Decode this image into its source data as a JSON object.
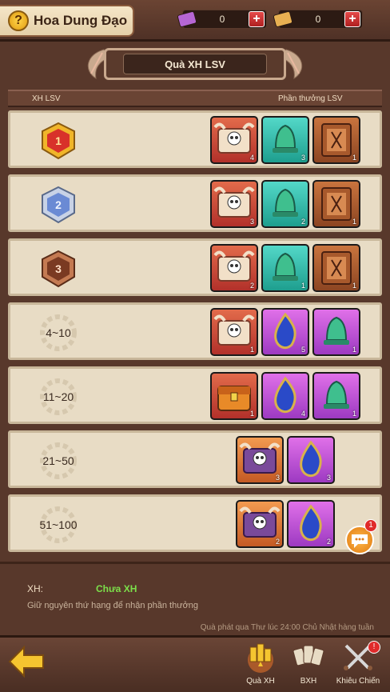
{
  "header": {
    "title": "Hoa Dung Đạo",
    "help": "?",
    "resources": [
      {
        "value": "0",
        "plus": "+",
        "color": "#b666d4"
      },
      {
        "value": "0",
        "plus": "+",
        "color": "#e8b052"
      }
    ]
  },
  "panel": {
    "title": "Quà XH LSV",
    "col_left": "XH LSV",
    "col_right": "Phần thưởng LSV"
  },
  "rows": [
    {
      "rank": "1",
      "items": [
        {
          "count": "4"
        },
        {
          "count": "3"
        },
        {
          "count": "1"
        }
      ]
    },
    {
      "rank": "2",
      "items": [
        {
          "count": "3"
        },
        {
          "count": "2"
        },
        {
          "count": "1"
        }
      ]
    },
    {
      "rank": "3",
      "items": [
        {
          "count": "2"
        },
        {
          "count": "1"
        },
        {
          "count": "1"
        }
      ]
    },
    {
      "rank": "4~10",
      "items": [
        {
          "count": "1"
        },
        {
          "count": "5"
        },
        {
          "count": "1"
        }
      ]
    },
    {
      "rank": "11~20",
      "items": [
        {
          "count": "1"
        },
        {
          "count": "4"
        },
        {
          "count": "1"
        }
      ]
    },
    {
      "rank": "21~50",
      "items": [
        {
          "count": "3"
        },
        {
          "count": "3"
        }
      ]
    },
    {
      "rank": "51~100",
      "items": [
        {
          "count": "2"
        },
        {
          "count": "2"
        }
      ]
    }
  ],
  "info": {
    "label": "XH:",
    "status": "Chưa XH",
    "desc": "Giữ nguyên thứ hạng để nhận phần thưởng",
    "time": "Quà phát qua Thư lúc 24:00 Chủ Nhật hàng tuần"
  },
  "chat_badge": "1",
  "nav": [
    {
      "label": "Quà XH",
      "active": true
    },
    {
      "label": "BXH"
    },
    {
      "label": "Khiêu Chiến",
      "badge": "!"
    }
  ]
}
